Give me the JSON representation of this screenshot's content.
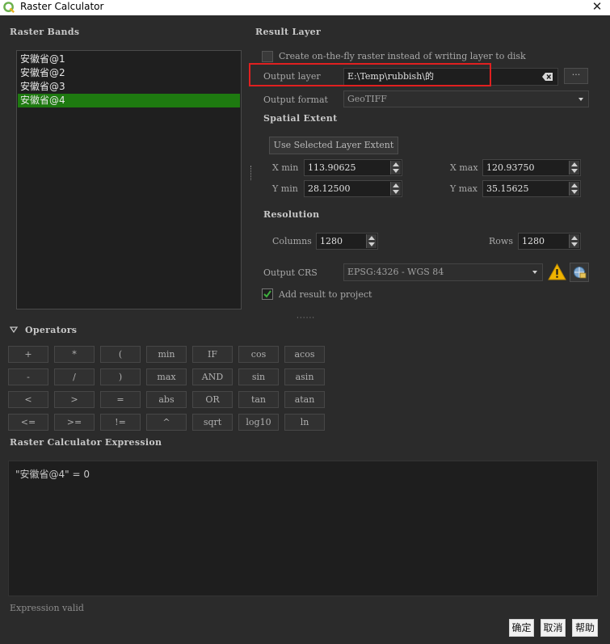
{
  "window": {
    "title": "Raster Calculator",
    "close_glyph": "✕"
  },
  "raster_bands": {
    "header": "Raster Bands",
    "items": [
      "安徽省@1",
      "安徽省@2",
      "安徽省@3",
      "安徽省@4"
    ],
    "selected_index": 3
  },
  "result_layer": {
    "header": "Result Layer",
    "on_the_fly_label": "Create on-the-fly raster instead of writing layer to disk",
    "on_the_fly_checked": false,
    "output_layer_label": "Output layer",
    "output_layer_value": "E:\\Temp\\rubbish\\的",
    "browse_label": "···",
    "output_format_label": "Output format",
    "output_format_value": "GeoTIFF"
  },
  "spatial_extent": {
    "header": "Spatial Extent",
    "use_selected_label": "Use Selected Layer Extent",
    "xmin_label": "X min",
    "xmin_value": "113.90625",
    "xmax_label": "X max",
    "xmax_value": "120.93750",
    "ymin_label": "Y min",
    "ymin_value": "28.12500",
    "ymax_label": "Y max",
    "ymax_value": "35.15625"
  },
  "resolution": {
    "header": "Resolution",
    "columns_label": "Columns",
    "columns_value": "1280",
    "rows_label": "Rows",
    "rows_value": "1280"
  },
  "output_crs": {
    "label": "Output CRS",
    "value": "EPSG:4326 - WGS 84",
    "add_result_label": "Add result to project",
    "add_result_checked": true
  },
  "operators": {
    "header": "Operators",
    "rows": [
      [
        "+",
        "*",
        "(",
        "min",
        "IF",
        "cos",
        "acos"
      ],
      [
        "-",
        "/",
        ")",
        "max",
        "AND",
        "sin",
        "asin"
      ],
      [
        "<",
        ">",
        "=",
        "abs",
        "OR",
        "tan",
        "atan"
      ],
      [
        "<=",
        ">=",
        "!=",
        "^",
        "sqrt",
        "log10",
        "ln"
      ]
    ]
  },
  "expression": {
    "header": "Raster Calculator Expression",
    "text": "\"安徽省@4\" = 0",
    "status": "Expression valid"
  },
  "dialog_buttons": {
    "ok": "确定",
    "cancel": "取消",
    "help": "帮助"
  },
  "colors": {
    "accent_selection": "#1e7a10",
    "highlight_box": "#e02020",
    "warning": "#f0b400",
    "qgis_green": "#6ab04c"
  }
}
